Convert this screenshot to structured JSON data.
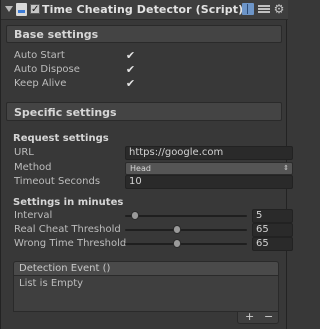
{
  "header": {
    "title": "Time Cheating Detector (Script)",
    "enabled_mark": "✓",
    "icons": [
      "script-icon",
      "help-book-icon",
      "preset-icon",
      "gear-icon"
    ],
    "gear_glyph": "⚙"
  },
  "base_settings": {
    "title": "Base settings",
    "items": [
      {
        "label": "Auto Start",
        "checked": true,
        "mark": "✔"
      },
      {
        "label": "Auto Dispose",
        "checked": true,
        "mark": "✔"
      },
      {
        "label": "Keep Alive",
        "checked": true,
        "mark": "✔"
      }
    ]
  },
  "specific_settings": {
    "title": "Specific settings",
    "request": {
      "title": "Request settings",
      "url_label": "URL",
      "url_value": "https://google.com",
      "method_label": "Method",
      "method_value": "Head",
      "method_arrow": "⇕",
      "timeout_label": "Timeout Seconds",
      "timeout_value": "10"
    },
    "minutes": {
      "title": "Settings in minutes",
      "sliders": [
        {
          "label": "Interval",
          "value": "5",
          "fraction": 0.05
        },
        {
          "label": "Real Cheat Threshold",
          "value": "65",
          "fraction": 0.42
        },
        {
          "label": "Wrong Time Threshold",
          "value": "65",
          "fraction": 0.42
        }
      ]
    }
  },
  "event": {
    "title": "Detection Event ()",
    "empty_text": "List is Empty",
    "add": "+",
    "remove": "−"
  },
  "colors": {
    "background": "#383838",
    "header": "#3e3e3e",
    "section": "#444444",
    "field": "#2a2a2a"
  }
}
